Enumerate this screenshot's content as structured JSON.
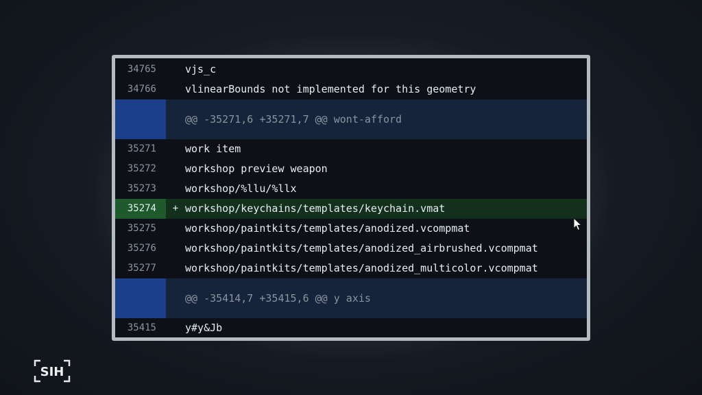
{
  "diff": {
    "rows": [
      {
        "num": "34765",
        "marker": "",
        "code": "vjs_c"
      },
      {
        "num": "34766",
        "marker": "",
        "code": "vlinearBounds not implemented for this geometry"
      },
      {
        "hunk": "@@ -35271,6 +35271,7 @@ wont-afford"
      },
      {
        "num": "35271",
        "marker": "",
        "code": "work item"
      },
      {
        "num": "35272",
        "marker": "",
        "code": "workshop preview weapon"
      },
      {
        "num": "35273",
        "marker": "",
        "code": "workshop/%llu/%llx"
      },
      {
        "num": "35274",
        "marker": "+",
        "code": "workshop/keychains/templates/keychain.vmat"
      },
      {
        "num": "35275",
        "marker": "",
        "code": "workshop/paintkits/templates/anodized.vcompmat"
      },
      {
        "num": "35276",
        "marker": "",
        "code": "workshop/paintkits/templates/anodized_airbrushed.vcompmat"
      },
      {
        "num": "35277",
        "marker": "",
        "code": "workshop/paintkits/templates/anodized_multicolor.vcompmat"
      },
      {
        "hunk": "@@ -35414,7 +35415,6 @@ y axis"
      },
      {
        "num": "35415",
        "marker": "",
        "code": "y#y&Jb"
      }
    ]
  },
  "colors": {
    "added_gutter": "#1f5a2c",
    "added_row": "#13301d",
    "hunk_gutter": "#1c3f8a",
    "hunk_row": "#15243a"
  },
  "logo": {
    "text": "SIH"
  }
}
